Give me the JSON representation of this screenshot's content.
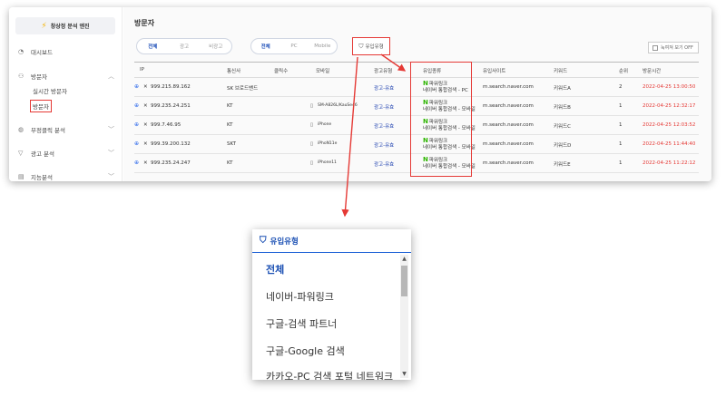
{
  "app": {
    "brand": "창상정 분석 엔진"
  },
  "sidebar": {
    "items": [
      {
        "label": "대시보드",
        "icon": "dashboard-icon"
      },
      {
        "label": "방문자",
        "icon": "visitor-icon"
      },
      {
        "label": "부정클릭 분석",
        "icon": "shield-icon"
      },
      {
        "label": "광고 분석",
        "icon": "filter-icon"
      },
      {
        "label": "지능분석",
        "icon": "chart-icon"
      }
    ],
    "subitems": [
      "실시간 방문자",
      "방문자"
    ]
  },
  "page": {
    "title": "방문자"
  },
  "filters": {
    "ad_tabs": [
      "전체",
      "광고",
      "비광고"
    ],
    "device_tabs": [
      "전체",
      "PC",
      "Mobile"
    ],
    "inflow_button": "유입유형",
    "toggle_label": "눅여져 보기 OFF"
  },
  "table": {
    "headers": [
      "IP",
      "통신사",
      "클릭수",
      "모바일",
      "광고유형",
      "유입종류",
      "유입사이트",
      "키워드",
      "순위",
      "방문시간"
    ],
    "rows": [
      {
        "ip": "999.215.89.162",
        "carrier": "SK 브로드밴드",
        "clicks": "",
        "mobile": "",
        "ad_type": "광고-유효",
        "src1": "파워링크",
        "src2": "네이버 통합검색 - PC",
        "site": "m.search.naver.com",
        "keyword": "키워드A",
        "rank": "2",
        "time": "2022-04-25 13:00:50"
      },
      {
        "ip": "999.235.24.251",
        "carrier": "KT",
        "clicks": "",
        "mobile": "SM-A826L/KauSe46",
        "ad_type": "광고-유효",
        "src1": "파워링크",
        "src2": "네이버 통합검색 - 모바일",
        "site": "m.search.naver.com",
        "keyword": "키워드B",
        "rank": "1",
        "time": "2022-04-25 12:32:17"
      },
      {
        "ip": "999.7.46.95",
        "carrier": "KT",
        "clicks": "",
        "mobile": "iPhone",
        "ad_type": "광고-유효",
        "src1": "파워링크",
        "src2": "네이버 통합검색 - 모바일",
        "site": "m.search.naver.com",
        "keyword": "키워드C",
        "rank": "1",
        "time": "2022-04-25 12:03:52"
      },
      {
        "ip": "999.39.200.132",
        "carrier": "SKT",
        "clicks": "",
        "mobile": "iPhoN11e",
        "ad_type": "광고-유효",
        "src1": "파워링크",
        "src2": "네이버 통합검색 - 모바일",
        "site": "m.search.naver.com",
        "keyword": "키워드D",
        "rank": "1",
        "time": "2022-04-25 11:44:40"
      },
      {
        "ip": "999.235.24.247",
        "carrier": "KT",
        "clicks": "",
        "mobile": "iPhone11",
        "ad_type": "광고-유효",
        "src1": "파워링크",
        "src2": "네이버 통합검색 - 모바일",
        "site": "m.search.naver.com",
        "keyword": "키워드E",
        "rank": "1",
        "time": "2022-04-25 11:22:12"
      }
    ]
  },
  "dropdown": {
    "title": "유입유형",
    "options": [
      "전체",
      "네이버-파워링크",
      "구글-검색 파트너",
      "구글-Google 검색",
      "카카오-PC 검색 포털 네트워크"
    ],
    "selected": "전체"
  },
  "colors": {
    "accent": "#1a4fb3",
    "highlight": "#e53935",
    "naver_green": "#2db400",
    "time_red": "#e53935"
  }
}
